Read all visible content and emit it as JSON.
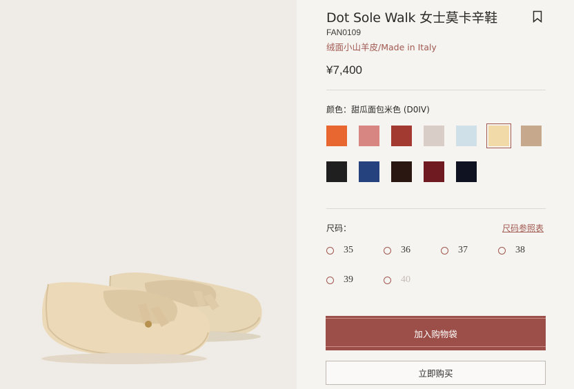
{
  "product": {
    "title": "Dot Sole Walk 女士莫卡辛鞋",
    "sku": "FAN0109",
    "material": "绒面小山羊皮/Made in Italy",
    "price": "¥7,400"
  },
  "color": {
    "label": "颜色：甜瓜面包米色 (D0IV)",
    "selected_index": 5,
    "swatches": [
      {
        "name": "orange",
        "hex": "#e8662f"
      },
      {
        "name": "rose",
        "hex": "#d88682"
      },
      {
        "name": "red",
        "hex": "#a33a31"
      },
      {
        "name": "light-grey",
        "hex": "#d8cec7"
      },
      {
        "name": "light-blue",
        "hex": "#cfe0e9"
      },
      {
        "name": "beige",
        "hex": "#f1d9a8"
      },
      {
        "name": "tan",
        "hex": "#c6a88c"
      },
      {
        "name": "black",
        "hex": "#1f1f1f"
      },
      {
        "name": "navy",
        "hex": "#25427e"
      },
      {
        "name": "dark-brown",
        "hex": "#2a1712"
      },
      {
        "name": "burgundy",
        "hex": "#6e1a20"
      },
      {
        "name": "dark-navy",
        "hex": "#0f1220"
      }
    ]
  },
  "size": {
    "label": "尺码：",
    "guide_label": "尺码参照表",
    "options": [
      {
        "value": "35",
        "available": true
      },
      {
        "value": "36",
        "available": true
      },
      {
        "value": "37",
        "available": true
      },
      {
        "value": "38",
        "available": true
      },
      {
        "value": "39",
        "available": true
      },
      {
        "value": "40",
        "available": false
      }
    ]
  },
  "actions": {
    "add_to_bag": "加入购物袋",
    "buy_now": "立即购买"
  },
  "icons": {
    "bookmark": "bookmark-icon"
  },
  "colors": {
    "accent": "#9c4f48",
    "background": "#f6f4f1"
  }
}
